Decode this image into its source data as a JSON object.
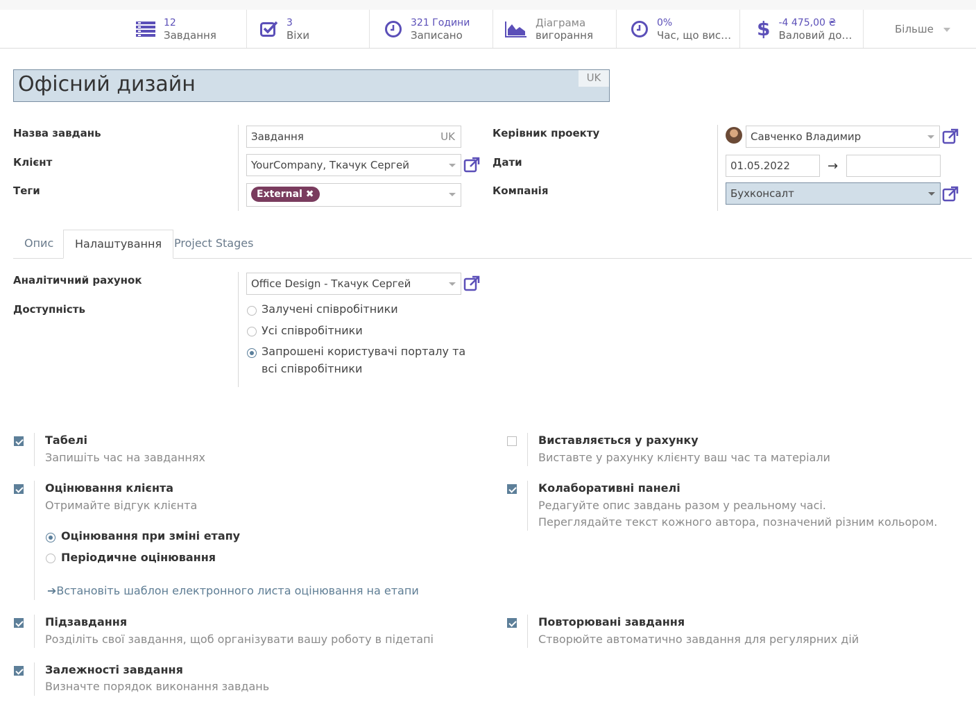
{
  "stats": [
    {
      "value": "12",
      "label": "Завдання",
      "icon": "tasks-list-icon"
    },
    {
      "value": "3",
      "label": "Віхи",
      "icon": "check-square-icon"
    },
    {
      "value": "321 Години",
      "label": "Записано",
      "icon": "clock-icon"
    },
    {
      "value": "Діаграма",
      "label": "вигорання",
      "icon": "area-chart-icon"
    },
    {
      "value": "0%",
      "label": "Час, що вист...",
      "icon": "clock-icon"
    },
    {
      "value": "-4 475,00 ₴",
      "label": "Валовий дохід",
      "icon": "dollar-icon"
    }
  ],
  "more_label": "Більше",
  "project": {
    "title": "Офісний дизайн",
    "lang": "UK"
  },
  "form": {
    "task_name_label": "Назва завдань",
    "task_name_value": "Завдання",
    "task_name_lang": "UK",
    "client_label": "Клієнт",
    "client_value": "YourCompany, Ткачук Сергей",
    "tags_label": "Теги",
    "tag": "External ✖",
    "manager_label": "Керівник проекту",
    "manager_value": "Савченко Владимир",
    "dates_label": "Дати",
    "date_start": "01.05.2022",
    "date_end": "",
    "date_arrow": "→",
    "company_label": "Компанія",
    "company_value": "Бухконсалт"
  },
  "tabs": [
    "Опис",
    "Налаштування",
    "Project Stages"
  ],
  "settings": {
    "analytic_label": "Аналітичний рахунок",
    "analytic_value": "Office Design - Ткачук Сергей",
    "visibility_label": "Доступність",
    "visibility_options": [
      "Залучені співробітники",
      "Усі співробітники",
      "Запрошені користувачі порталу та",
      "всі співробітники"
    ],
    "visibility_selected": 2
  },
  "features": {
    "timesheets": {
      "title": "Табелі",
      "desc": "Запишіть час на завданнях",
      "checked": true
    },
    "rating": {
      "title": "Оцінювання клієнта",
      "desc": "Отримайте відгук клієнта",
      "checked": true,
      "opt1": "Оцінювання при зміні етапу",
      "opt2": "Періодичне оцінювання",
      "link": "Встановіть шаблон електронного листа оцінювання на етапи"
    },
    "subtasks": {
      "title": "Підзавдання",
      "desc": "Розділіть свої завдання, щоб організувати вашу роботу в підетапі",
      "checked": true
    },
    "dependencies": {
      "title": "Залежності завдання",
      "desc": "Визначте порядок виконання завдань",
      "checked": true
    },
    "billable": {
      "title": "Виставляється у рахунку",
      "desc": "Виставте у рахунку клієнту ваш час та матеріали",
      "checked": false
    },
    "pads": {
      "title": "Колаборативні панелі",
      "desc1": "Редагуйте опис завдань разом у реальному часі.",
      "desc2": "Переглядайте текст кожного автора, позначений різним кольором.",
      "checked": true
    },
    "recurring": {
      "title": "Повторювані завдання",
      "desc": "Створюйте автоматично завдання для регулярних дій",
      "checked": true
    }
  },
  "colors": {
    "accent": "#5b4fb8",
    "title_bg": "#d1dee8",
    "tag_bg": "#7a3c5e",
    "check": "#5d7f99"
  }
}
